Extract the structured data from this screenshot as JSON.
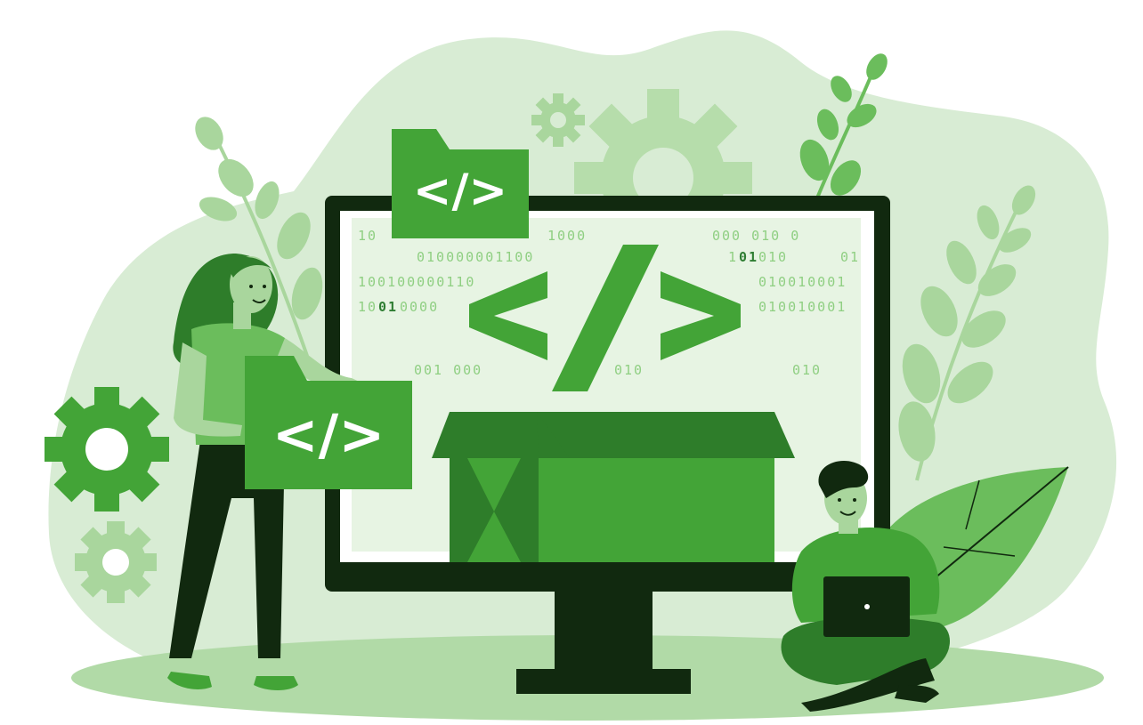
{
  "illustration": {
    "colors": {
      "background_blob": "#d8ecd4",
      "ground": "#b1daa7",
      "light_green": "#a9d69d",
      "mid_green": "#6bbd5c",
      "brand_green": "#43a437",
      "dark_green": "#2e7d2a",
      "darkest": "#11290f",
      "screen": "#e7f4e3",
      "white": "#ffffff"
    },
    "screen_code_symbol": "</>",
    "top_folder_symbol": "</>",
    "held_folder_symbol": "</>",
    "binary_lines": [
      {
        "text": "10"
      },
      {
        "text": "1000"
      },
      {
        "text": "000 010   0"
      },
      {
        "text": "010000001100"
      },
      {
        "text": "1"
      },
      {
        "text": "01",
        "highlight": true
      },
      {
        "text": "010"
      },
      {
        "text": "01"
      },
      {
        "text": "100100000110"
      },
      {
        "text": "010010001"
      },
      {
        "text": "10"
      },
      {
        "text": "01",
        "highlight": true
      },
      {
        "text": "0000"
      },
      {
        "text": "010010001"
      },
      {
        "text": "001  000"
      },
      {
        "text": "010"
      },
      {
        "text": "010"
      }
    ],
    "icons": [
      "gear-icon",
      "leaf-branch-icon",
      "folder-icon",
      "box-icon",
      "laptop-icon",
      "monitor-icon"
    ]
  }
}
